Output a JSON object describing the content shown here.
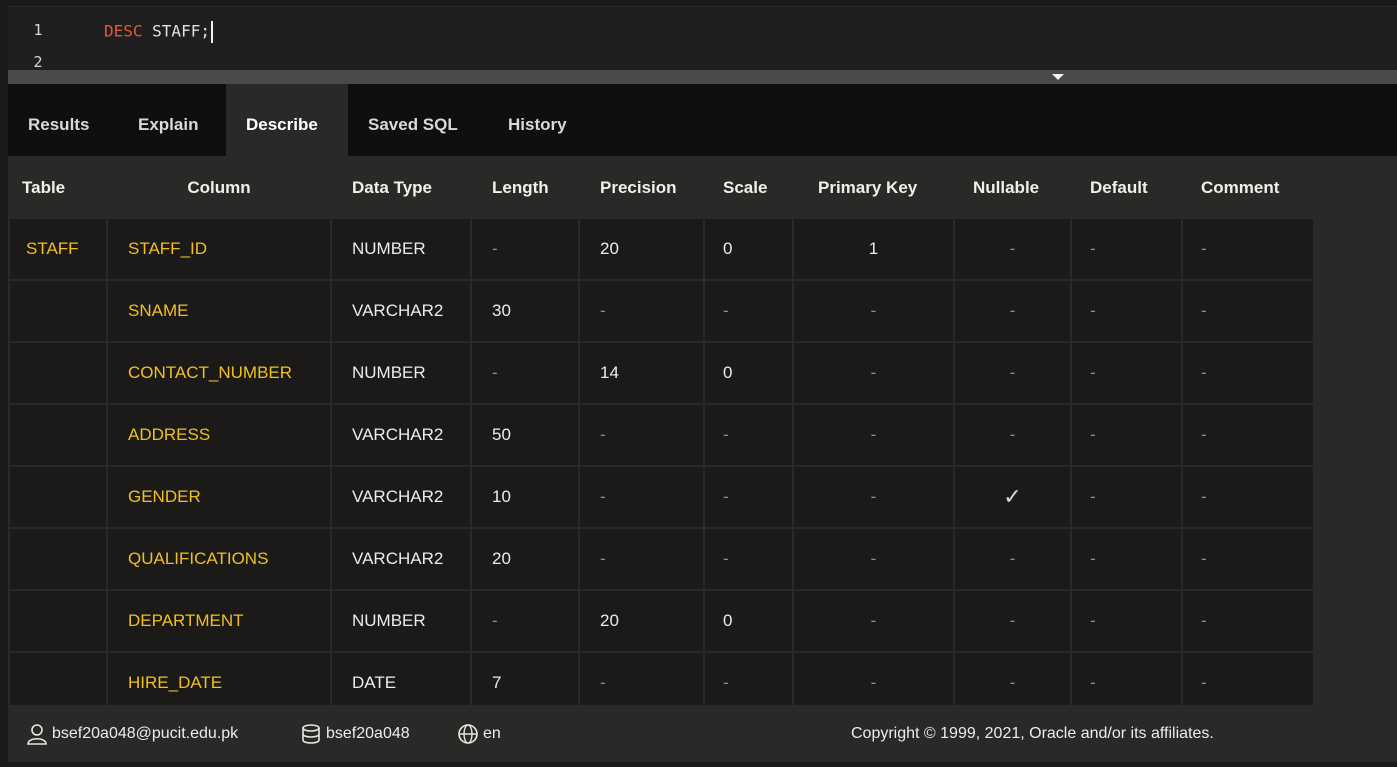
{
  "editor": {
    "lines": [
      "1",
      "2"
    ],
    "keyword": "DESC",
    "code_rest": " STAFF;"
  },
  "tabs": [
    "Results",
    "Explain",
    "Describe",
    "Saved SQL",
    "History"
  ],
  "active_tab": "Describe",
  "table": {
    "headers": [
      "Table",
      "Column",
      "Data Type",
      "Length",
      "Precision",
      "Scale",
      "Primary Key",
      "Nullable",
      "Default",
      "Comment"
    ],
    "rows": [
      [
        "STAFF",
        "STAFF_ID",
        "NUMBER",
        "-",
        "20",
        "0",
        "1",
        "-",
        "-",
        "-"
      ],
      [
        "",
        "SNAME",
        "VARCHAR2",
        "30",
        "-",
        "-",
        "-",
        "-",
        "-",
        "-"
      ],
      [
        "",
        "CONTACT_NUMBER",
        "NUMBER",
        "-",
        "14",
        "0",
        "-",
        "-",
        "-",
        "-"
      ],
      [
        "",
        "ADDRESS",
        "VARCHAR2",
        "50",
        "-",
        "-",
        "-",
        "-",
        "-",
        "-"
      ],
      [
        "",
        "GENDER",
        "VARCHAR2",
        "10",
        "-",
        "-",
        "-",
        "✓",
        "-",
        "-"
      ],
      [
        "",
        "QUALIFICATIONS",
        "VARCHAR2",
        "20",
        "-",
        "-",
        "-",
        "-",
        "-",
        "-"
      ],
      [
        "",
        "DEPARTMENT",
        "NUMBER",
        "-",
        "20",
        "0",
        "-",
        "-",
        "-",
        "-"
      ],
      [
        "",
        "HIRE_DATE",
        "DATE",
        "7",
        "-",
        "-",
        "-",
        "-",
        "-",
        "-"
      ]
    ]
  },
  "footer": {
    "user": "bsef20a048@pucit.edu.pk",
    "schema": "bsef20a048",
    "language": "en",
    "copyright": "Copyright © 1999, 2021, Oracle and/or its affiliates."
  },
  "colors": {
    "keyword": "#e8563a",
    "column_name": "#f0c020",
    "background": "#1b1a19",
    "header": "#2a2927"
  },
  "icons": [
    "user-icon",
    "database-icon",
    "globe-icon",
    "dropdown-arrow-icon",
    "checkmark-icon"
  ]
}
